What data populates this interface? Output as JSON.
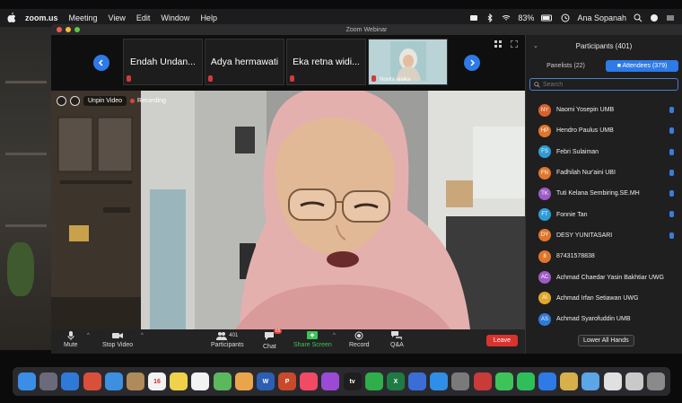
{
  "menubar": {
    "app_name": "zoom.us",
    "items": [
      "Meeting",
      "View",
      "Edit",
      "Window",
      "Help"
    ],
    "battery": "83%",
    "user": "Ana Sopanah"
  },
  "window": {
    "title": "Zoom Webinar"
  },
  "strip": {
    "tiles": [
      "Endah Undan...",
      "Adya hermawati",
      "Eka retna widi..."
    ],
    "photo_tile_name": "Novita alaika"
  },
  "video": {
    "unpin_label": "Unpin Video",
    "recording_label": "Recording"
  },
  "controls": {
    "mute": "Mute",
    "stop_video": "Stop Video",
    "participants": "Participants",
    "participants_count": "401",
    "chat": "Chat",
    "chat_badge": "65",
    "share_screen": "Share Screen",
    "record": "Record",
    "qa": "Q&A",
    "leave": "Leave"
  },
  "panel": {
    "title": "Participants (401)",
    "tab_panelists": "Panelists (22)",
    "tab_attendees": "Attendees (379)",
    "search_placeholder": "Search",
    "participants": [
      {
        "initials": "NY",
        "name": "Naomi Yosepin UMB",
        "color": "#d9602c",
        "hand": true
      },
      {
        "initials": "HP",
        "name": "Hendro Paulus UMB",
        "color": "#e0762a",
        "hand": true
      },
      {
        "initials": "FS",
        "name": "Febri Sulaiman",
        "color": "#2f9bd6",
        "hand": true
      },
      {
        "initials": "FN",
        "name": "Fadhilah Nur'aini UBI",
        "color": "#e0762a",
        "hand": true
      },
      {
        "initials": "TK",
        "name": "Tuti Kelana Sembiring.SE.MH",
        "color": "#9d5bc5",
        "hand": true
      },
      {
        "initials": "FT",
        "name": "Fonnie Tan",
        "color": "#2f9bd6",
        "hand": true
      },
      {
        "initials": "DY",
        "name": "DESY YUNITASARI",
        "color": "#e0762a",
        "hand": true
      },
      {
        "initials": "8",
        "name": "87431578838",
        "color": "#e0762a",
        "hand": false
      },
      {
        "initials": "AC",
        "name": "Achmad Chaedar Yasin Bakhtiar UWG",
        "color": "#9d5bc5",
        "hand": false
      },
      {
        "initials": "AI",
        "name": "Achmad Irfan Setiawan UWG",
        "color": "#e0a82a",
        "hand": false
      },
      {
        "initials": "AS",
        "name": "Achmad Syarofuddin UMB",
        "color": "#2f7ad6",
        "hand": false
      }
    ],
    "lower_all": "Lower All Hands"
  },
  "dock": {
    "apps": [
      {
        "name": "finder-icon",
        "color": "#3a8ee6",
        "glyph": ""
      },
      {
        "name": "launchpad-icon",
        "color": "#6a6a7a",
        "glyph": ""
      },
      {
        "name": "safari-icon",
        "color": "#2f7ad6",
        "glyph": ""
      },
      {
        "name": "chrome-icon",
        "color": "#d9503a",
        "glyph": ""
      },
      {
        "name": "mail-icon",
        "color": "#3d8fe0",
        "glyph": ""
      },
      {
        "name": "contacts-icon",
        "color": "#b08a5a",
        "glyph": ""
      },
      {
        "name": "calendar-icon",
        "color": "#f2f2f2",
        "glyph": "16"
      },
      {
        "name": "notes-icon",
        "color": "#f0d24a",
        "glyph": ""
      },
      {
        "name": "reminders-icon",
        "color": "#f2f2f2",
        "glyph": ""
      },
      {
        "name": "maps-icon",
        "color": "#5cb85c",
        "glyph": ""
      },
      {
        "name": "photos-icon",
        "color": "#e9a54a",
        "glyph": ""
      },
      {
        "name": "word-icon",
        "color": "#2b5fb4",
        "glyph": "W"
      },
      {
        "name": "powerpoint-icon",
        "color": "#c94a2a",
        "glyph": "P"
      },
      {
        "name": "music-icon",
        "color": "#f04a64",
        "glyph": ""
      },
      {
        "name": "podcasts-icon",
        "color": "#9b4ad6",
        "glyph": ""
      },
      {
        "name": "tv-icon",
        "color": "#1e1e1e",
        "glyph": "tv"
      },
      {
        "name": "numbers-icon",
        "color": "#2fae4a",
        "glyph": ""
      },
      {
        "name": "excel-icon",
        "color": "#1f7a44",
        "glyph": "X"
      },
      {
        "name": "keynote-icon",
        "color": "#3a6ed6",
        "glyph": ""
      },
      {
        "name": "appstore-icon",
        "color": "#2f8fe6",
        "glyph": ""
      },
      {
        "name": "settings-icon",
        "color": "#7a7a7a",
        "glyph": ""
      },
      {
        "name": "photo-booth-icon",
        "color": "#c93a3a",
        "glyph": ""
      },
      {
        "name": "messages-icon",
        "color": "#3ec35a",
        "glyph": ""
      },
      {
        "name": "whatsapp-icon",
        "color": "#2fbf5a",
        "glyph": ""
      },
      {
        "name": "zoom-icon",
        "color": "#2e7ae6",
        "glyph": ""
      },
      {
        "name": "archive-icon",
        "color": "#d6b04a",
        "glyph": ""
      },
      {
        "name": "folder-icon",
        "color": "#5aa6e6",
        "glyph": ""
      },
      {
        "name": "documents-icon",
        "color": "#e0e0e0",
        "glyph": ""
      },
      {
        "name": "downloads-icon",
        "color": "#c9c9c9",
        "glyph": ""
      },
      {
        "name": "trash-icon",
        "color": "#8a8a8a",
        "glyph": ""
      }
    ]
  }
}
